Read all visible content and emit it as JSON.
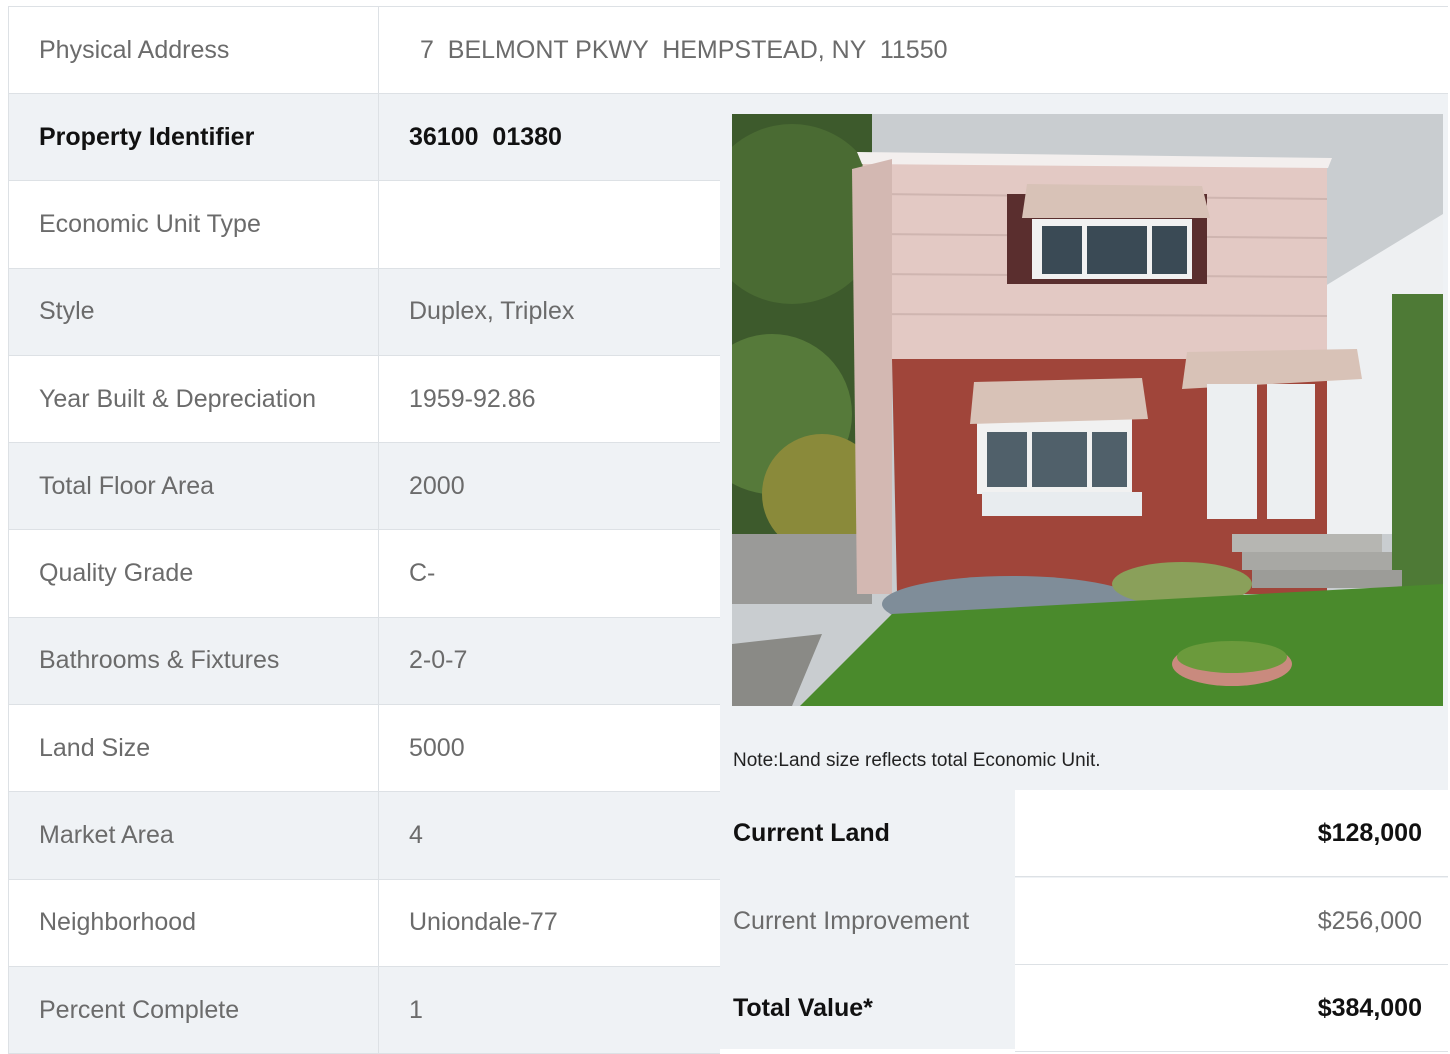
{
  "address": {
    "label": "Physical Address",
    "value": "7  BELMONT PKWY  HEMPSTEAD, NY  11550"
  },
  "details": [
    {
      "label": "Property Identifier",
      "value": "36100  01380"
    },
    {
      "label": "Economic Unit Type",
      "value": ""
    },
    {
      "label": "Style",
      "value": "Duplex, Triplex"
    },
    {
      "label": "Year Built & Depreciation",
      "value": "1959-92.86"
    },
    {
      "label": "Total Floor Area",
      "value": "2000"
    },
    {
      "label": "Quality Grade",
      "value": "C-"
    },
    {
      "label": "Bathrooms & Fixtures",
      "value": "2-0-7"
    },
    {
      "label": "Land Size",
      "value": "5000"
    },
    {
      "label": "Market Area",
      "value": "4"
    },
    {
      "label": "Neighborhood",
      "value": "Uniondale-77"
    },
    {
      "label": "Percent Complete",
      "value": "1"
    }
  ],
  "note": "Note:Land size reflects total Economic Unit.",
  "valuation": [
    {
      "label": "Current Land",
      "value": "$128,000"
    },
    {
      "label": "Current Improvement",
      "value": "$256,000"
    },
    {
      "label": "Total Value*",
      "value": "$384,000"
    }
  ]
}
